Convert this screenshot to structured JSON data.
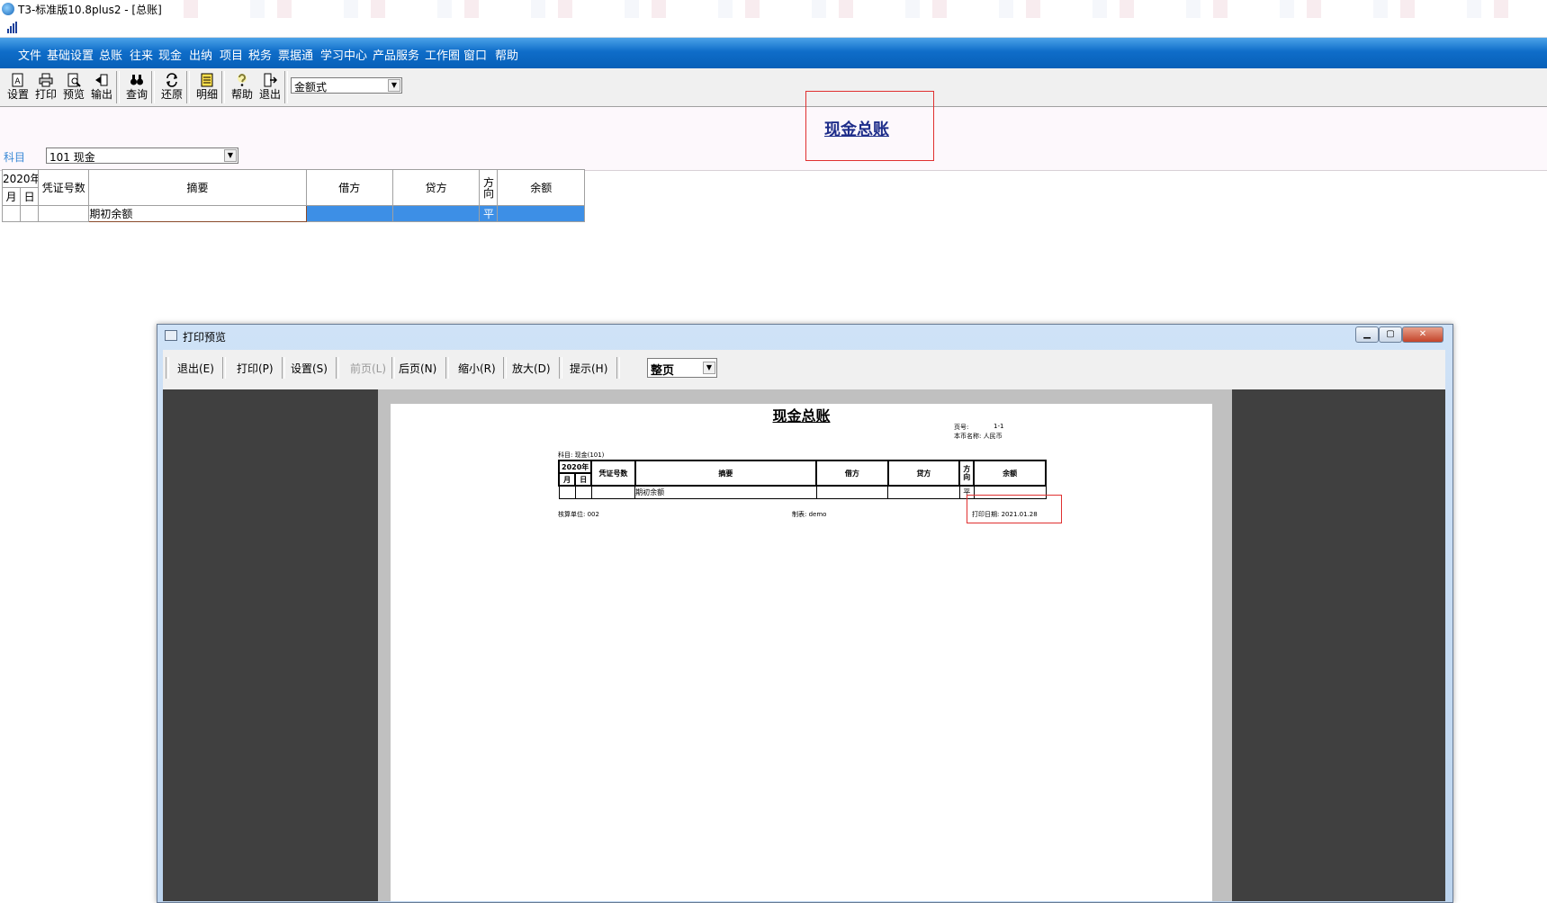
{
  "window": {
    "title": "T3-标准版10.8plus2 - [总账]"
  },
  "menu": [
    "文件",
    "基础设置",
    "总账",
    "往来",
    "现金",
    "出纳",
    "项目",
    "税务",
    "票据通",
    "学习中心",
    "产品服务",
    "工作圈",
    "窗口",
    "帮助"
  ],
  "toolbar": {
    "buttons": [
      {
        "label": "设置",
        "icon": "settings-icon"
      },
      {
        "label": "打印",
        "icon": "printer-icon"
      },
      {
        "label": "预览",
        "icon": "preview-icon"
      },
      {
        "label": "输出",
        "icon": "export-icon"
      },
      {
        "label": "查询",
        "icon": "binoculars-icon"
      },
      {
        "label": "还原",
        "icon": "restore-icon"
      },
      {
        "label": "明细",
        "icon": "detail-icon"
      },
      {
        "label": "帮助",
        "icon": "help-icon"
      },
      {
        "label": "退出",
        "icon": "exit-icon"
      }
    ],
    "format_select": "金额式"
  },
  "ledger": {
    "title": "现金总账",
    "subject_label": "科目",
    "subject_value": "101  现金",
    "headers": {
      "year": "2020年",
      "month": "月",
      "day": "日",
      "voucher_count": "凭证号数",
      "summary": "摘要",
      "debit": "借方",
      "credit": "贷方",
      "direction": "方向",
      "balance": "余额"
    },
    "rows": [
      {
        "month": "",
        "day": "",
        "voucher": "",
        "summary": "期初余额",
        "debit": "",
        "credit": "",
        "direction": "平",
        "balance": ""
      }
    ]
  },
  "preview": {
    "title": "打印预览",
    "buttons": [
      {
        "label": "退出(E)",
        "enabled": true
      },
      {
        "label": "打印(P)",
        "enabled": true
      },
      {
        "label": "设置(S)",
        "enabled": true
      },
      {
        "label": "前页(L)",
        "enabled": false
      },
      {
        "label": "后页(N)",
        "enabled": true
      },
      {
        "label": "缩小(R)",
        "enabled": true
      },
      {
        "label": "放大(D)",
        "enabled": true
      },
      {
        "label": "提示(H)",
        "enabled": true
      }
    ],
    "zoom": "整页",
    "page": {
      "title": "现金总账",
      "page_no_label": "页号:",
      "page_no": "1-1",
      "currency": "本币名称: 人民币",
      "subject": "科目: 现金(101)",
      "org": "核算单位: 002",
      "maker": "制表: demo",
      "print_date": "打印日期: 2021.01.28"
    }
  },
  "colors": {
    "menu": "#0f6dc9",
    "selection": "#3d8fe6",
    "title_link": "#1e2d8a",
    "highlight_box": "#e03030"
  }
}
